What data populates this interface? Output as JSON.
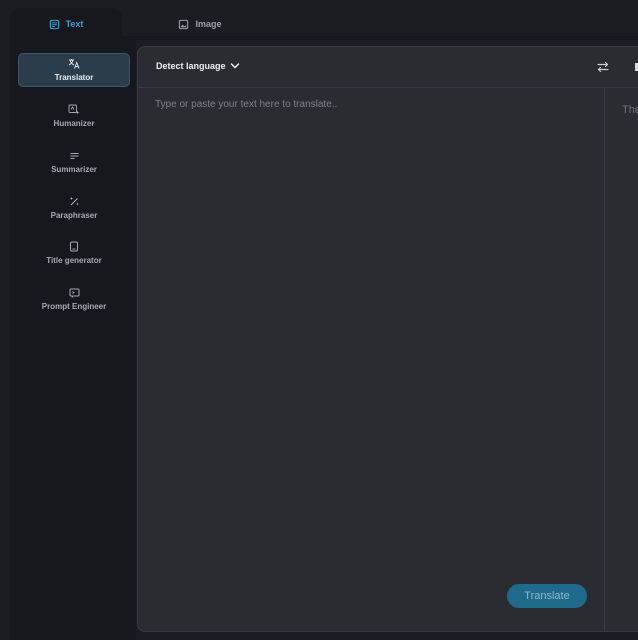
{
  "tabs": {
    "text_label": "Text",
    "image_label": "Image"
  },
  "sidebar": {
    "items": [
      {
        "label": "Translator",
        "icon": "translate-icon",
        "active": true
      },
      {
        "label": "Humanizer",
        "icon": "humanizer-icon",
        "active": false
      },
      {
        "label": "Summarizer",
        "icon": "summarizer-icon",
        "active": false
      },
      {
        "label": "Paraphraser",
        "icon": "magic-wand-icon",
        "active": false
      },
      {
        "label": "Title generator",
        "icon": "title-card-icon",
        "active": false
      },
      {
        "label": "Prompt Engineer",
        "icon": "prompt-icon",
        "active": false
      }
    ]
  },
  "translator": {
    "source_language": "Detect language",
    "source_placeholder": "Type or paste your text here to translate..",
    "source_value": "",
    "target_placeholder": "The",
    "translate_label": "Translate"
  },
  "colors": {
    "accent": "#3aa3d8",
    "background": "#1b1d23",
    "sidebar": "#16181e",
    "panel": "#2a2c32",
    "active_item": "#2b3d4b",
    "button": "#1d6a8a"
  }
}
